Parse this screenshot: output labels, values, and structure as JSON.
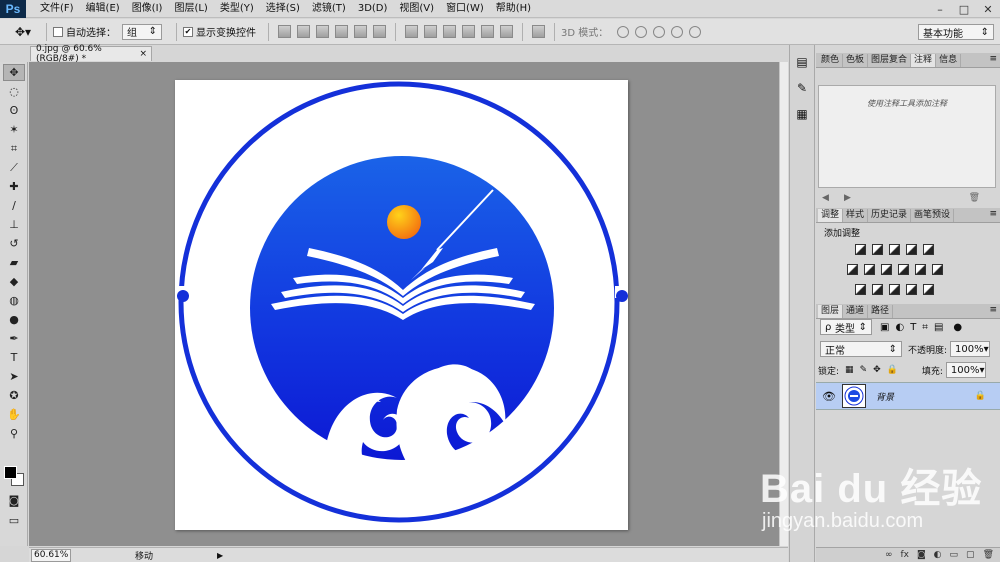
{
  "app": {
    "logo": "Ps"
  },
  "menu": [
    "文件(F)",
    "编辑(E)",
    "图像(I)",
    "图层(L)",
    "类型(Y)",
    "选择(S)",
    "滤镜(T)",
    "3D(D)",
    "视图(V)",
    "窗口(W)",
    "帮助(H)"
  ],
  "window_controls": {
    "minimize": "–",
    "maximize": "□",
    "close": "✕"
  },
  "options": {
    "tool_icon": "move-tool-icon",
    "auto_select_label": "自动选择：",
    "auto_select_checked": false,
    "auto_select_value": "组",
    "show_transform_label": "显示变换控件",
    "show_transform_checked": true,
    "mode_3d_label": "3D 模式：",
    "workspace": "基本功能"
  },
  "document": {
    "tab_title": "0.jpg @ 60.6%(RGB/8#) *",
    "tab_close": "×"
  },
  "status": {
    "zoom": "60.61%",
    "text": "移动",
    "arrow": "▶"
  },
  "panels": {
    "notes_tabs": [
      "颜色",
      "色板",
      "图层复合",
      "注释",
      "信息"
    ],
    "notes_active": "注释",
    "notes_hint": "使用注释工具添加注释",
    "adjust_tabs": [
      "调整",
      "样式",
      "历史记录",
      "画笔预设"
    ],
    "adjust_title": "添加调整",
    "layer_tabs": [
      "图层",
      "通道",
      "路径"
    ],
    "filter_kind": "类型",
    "blend_mode": "正常",
    "opacity_label": "不透明度:",
    "opacity_value": "100%",
    "lock_label": "锁定:",
    "fill_label": "填充:",
    "fill_value": "100%",
    "layer_name": "背景"
  },
  "colors": {
    "logo_blue": "#1430d9",
    "layer_selected": "#b7cdf3",
    "canvas_bg": "#8f8f8f"
  },
  "watermark": {
    "logo": "Bai du 经验",
    "url": "jingyan.baidu.com"
  }
}
